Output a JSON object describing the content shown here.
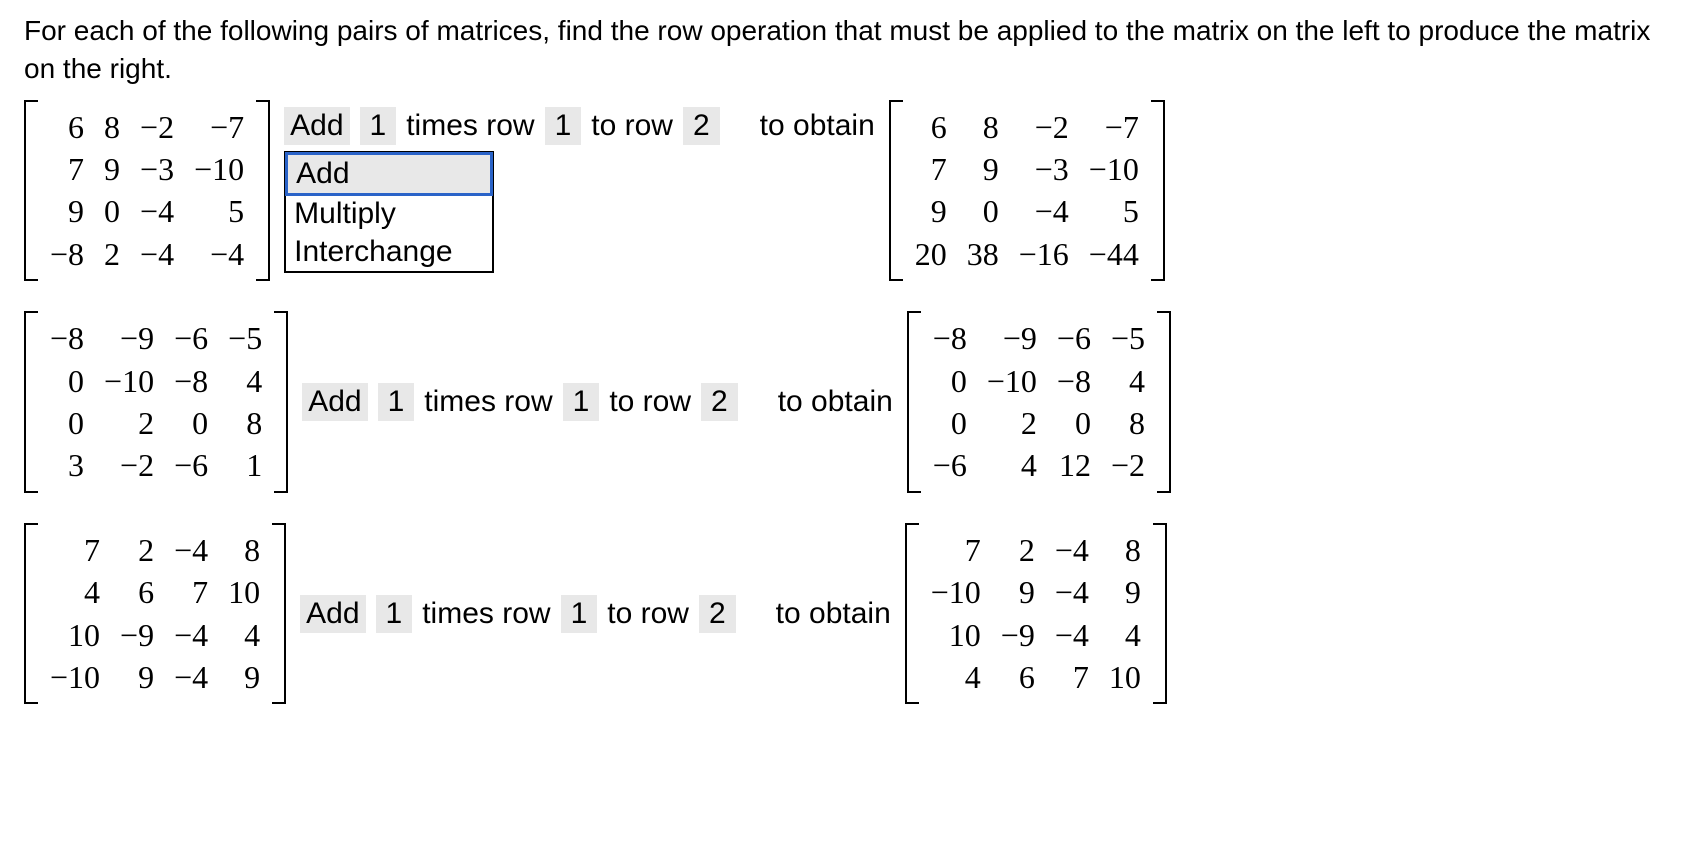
{
  "question": "For each of the following pairs of matrices, find the row operation that must be applied to the matrix on the left to produce the matrix on the right.",
  "to_obtain": "to obtain",
  "dropdown": {
    "options": [
      "Add",
      "Multiply",
      "Interchange"
    ]
  },
  "problems": [
    {
      "left": [
        [
          "6",
          "8",
          "−2",
          "−7"
        ],
        [
          "7",
          "9",
          "−3",
          "−10"
        ],
        [
          "9",
          "0",
          "−4",
          "5"
        ],
        [
          "−8",
          "2",
          "−4",
          "−4"
        ]
      ],
      "right": [
        [
          "6",
          "8",
          "−2",
          "−7"
        ],
        [
          "7",
          "9",
          "−3",
          "−10"
        ],
        [
          "9",
          "0",
          "−4",
          "5"
        ],
        [
          "20",
          "38",
          "−16",
          "−44"
        ]
      ],
      "op": {
        "verb": "Add",
        "scalar": "1",
        "word_times": "times row",
        "rowA": "1",
        "word_to": "to row",
        "rowB": "2"
      },
      "show_dropdown": true
    },
    {
      "left": [
        [
          "−8",
          "−9",
          "−6",
          "−5"
        ],
        [
          "0",
          "−10",
          "−8",
          "4"
        ],
        [
          "0",
          "2",
          "0",
          "8"
        ],
        [
          "3",
          "−2",
          "−6",
          "1"
        ]
      ],
      "right": [
        [
          "−8",
          "−9",
          "−6",
          "−5"
        ],
        [
          "0",
          "−10",
          "−8",
          "4"
        ],
        [
          "0",
          "2",
          "0",
          "8"
        ],
        [
          "−6",
          "4",
          "12",
          "−2"
        ]
      ],
      "op": {
        "verb": "Add",
        "scalar": "1",
        "word_times": "times row",
        "rowA": "1",
        "word_to": "to row",
        "rowB": "2"
      },
      "show_dropdown": false
    },
    {
      "left": [
        [
          "7",
          "2",
          "−4",
          "8"
        ],
        [
          "4",
          "6",
          "7",
          "10"
        ],
        [
          "10",
          "−9",
          "−4",
          "4"
        ],
        [
          "−10",
          "9",
          "−4",
          "9"
        ]
      ],
      "right": [
        [
          "7",
          "2",
          "−4",
          "8"
        ],
        [
          "−10",
          "9",
          "−4",
          "9"
        ],
        [
          "10",
          "−9",
          "−4",
          "4"
        ],
        [
          "4",
          "6",
          "7",
          "10"
        ]
      ],
      "op": {
        "verb": "Add",
        "scalar": "1",
        "word_times": "times row",
        "rowA": "1",
        "word_to": "to row",
        "rowB": "2"
      },
      "show_dropdown": false
    }
  ]
}
